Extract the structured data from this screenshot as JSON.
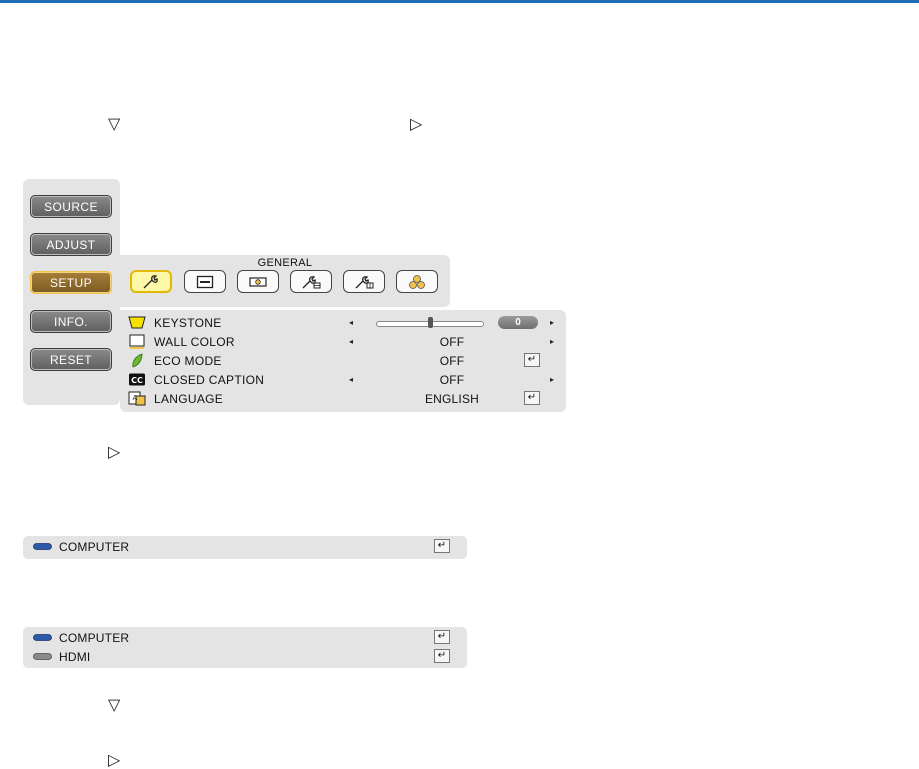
{
  "glyphs": {
    "down": "▽",
    "right": "▷"
  },
  "menu": {
    "items": [
      "SOURCE",
      "ADJUST",
      "SETUP",
      "INFO.",
      "RESET"
    ],
    "active": "SETUP"
  },
  "tabs": {
    "title": "GENERAL",
    "icons": [
      "wrench-icon",
      "menu-window-icon",
      "projector-icon",
      "wrench-settings-icon",
      "wrench-settings-icon",
      "balls-icon"
    ]
  },
  "settings": {
    "keystone": {
      "label": "KEYSTONE",
      "value": "0",
      "slider_fraction": 0.5
    },
    "wall_color": {
      "label": "WALL COLOR",
      "value": "OFF"
    },
    "eco_mode": {
      "label": "ECO MODE",
      "value": "OFF"
    },
    "closed_caption": {
      "label": "CLOSED CAPTION",
      "value": "OFF"
    },
    "language": {
      "label": "LANGUAGE",
      "value": "ENGLISH"
    }
  },
  "source_list_1": {
    "computer": "COMPUTER"
  },
  "source_list_2": {
    "computer": "COMPUTER",
    "hdmi": "HDMI"
  },
  "symbols": {
    "enter": "↵",
    "arrow_left": "◂",
    "arrow_right": "▸"
  },
  "colors": {
    "accent_rule": "#1f6fb8",
    "active_border": "#f0c24a",
    "active_tab_bg": "#fff8a8",
    "panel_bg": "#e4e4e4"
  }
}
